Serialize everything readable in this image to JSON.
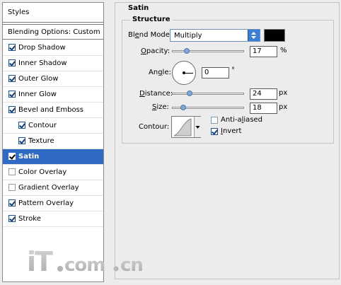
{
  "styles_panel": {
    "header": "Styles",
    "blending_options": "Blending Options: Custom",
    "effects": [
      {
        "label": "Drop Shadow",
        "checked": true
      },
      {
        "label": "Inner Shadow",
        "checked": true
      },
      {
        "label": "Outer Glow",
        "checked": true
      },
      {
        "label": "Inner Glow",
        "checked": true
      },
      {
        "label": "Bevel and Emboss",
        "checked": true
      },
      {
        "label": "Contour",
        "checked": true
      },
      {
        "label": "Texture",
        "checked": true
      },
      {
        "label": "Satin",
        "checked": true,
        "selected": true
      },
      {
        "label": "Color Overlay",
        "checked": false
      },
      {
        "label": "Gradient Overlay",
        "checked": false
      },
      {
        "label": "Pattern Overlay",
        "checked": true
      },
      {
        "label": "Stroke",
        "checked": true
      }
    ]
  },
  "satin": {
    "title": "Satin",
    "structure_title": "Structure",
    "blend_mode": {
      "label_pre": "Bl",
      "label_u": "e",
      "label_post": "nd Mode:",
      "value": "Multiply"
    },
    "color": "#000000",
    "opacity": {
      "label_u": "O",
      "label_post": "pacity:",
      "value": "17",
      "unit": "%",
      "level": 0.17
    },
    "angle": {
      "label_pre": "An",
      "label_u": "g",
      "label_post": "le:",
      "value": "0",
      "unit": "°"
    },
    "distance": {
      "label_u": "D",
      "label_post": "istance:",
      "value": "24",
      "unit": "px"
    },
    "size": {
      "label_u": "S",
      "label_post": "ize:",
      "value": "18",
      "unit": "px"
    },
    "contour": {
      "label": "Contour:"
    },
    "anti_aliased": {
      "label_pre": "Anti-a",
      "label_u": "l",
      "label_post": "iased",
      "checked": false
    },
    "invert": {
      "label_u": "I",
      "label_post": "nvert",
      "checked": true
    }
  },
  "watermark": {
    "text": "iT.com.cn"
  },
  "colors": {
    "selection": "#316ac5",
    "dropdown_arrow": "#3a7fd6"
  }
}
